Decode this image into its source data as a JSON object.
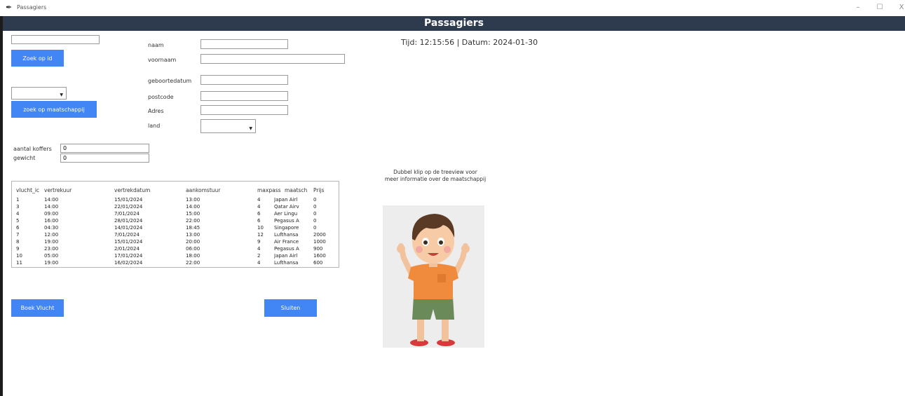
{
  "window": {
    "title": "Passagiers",
    "controls": {
      "minimize": "–",
      "maximize": "☐",
      "close": "X"
    }
  },
  "header": {
    "title": "Passagiers"
  },
  "clock": {
    "text": "Tijd: 12:15:56 | Datum: 2024-01-30"
  },
  "search": {
    "id_value": "",
    "id_button": "Zoek op id",
    "company_value": "",
    "company_button": "zoek op maatschappij"
  },
  "form": {
    "naam_label": "naam",
    "naam_value": "",
    "voornaam_label": "voornaam",
    "voornaam_value": "",
    "geboortedatum_label": "geboortedatum",
    "geboortedatum_value": "",
    "postcode_label": "postcode",
    "postcode_value": "",
    "adres_label": "Adres",
    "adres_value": "",
    "land_label": "land",
    "land_value": ""
  },
  "luggage": {
    "koffers_label": "aantal koffers",
    "koffers_value": "0",
    "gewicht_label": "gewicht",
    "gewicht_value": "0"
  },
  "hint": {
    "line1": "Dubbel klip op de treeview voor",
    "line2": "meer informatie over de maatschappij"
  },
  "table": {
    "columns": [
      "vlucht_ic",
      "vertrekuur",
      "vertrekdatum",
      "aankomstuur",
      "maxpass",
      "maatsch",
      "Prijs"
    ],
    "rows": [
      [
        "1",
        "14:00",
        "15/01/2024",
        "13:00",
        "4",
        "Japan Airl",
        "0"
      ],
      [
        "3",
        "14:00",
        "22/01/2024",
        "14:00",
        "4",
        "Qatar Airv",
        "0"
      ],
      [
        "4",
        "09:00",
        "7/01/2024",
        "15:00",
        "6",
        "Aer Lingu",
        "0"
      ],
      [
        "5",
        "16:00",
        "28/01/2024",
        "22:00",
        "6",
        "Pegasus A",
        "0"
      ],
      [
        "6",
        "04:30",
        "14/01/2024",
        "18:45",
        "10",
        "Singapore",
        "0"
      ],
      [
        "7",
        "12:00",
        "7/01/2024",
        "13:00",
        "12",
        "Lufthansa",
        "2000"
      ],
      [
        "8",
        "19:00",
        "15/01/2024",
        "20:00",
        "9",
        "Air France",
        "1000"
      ],
      [
        "9",
        "23:00",
        "2/01/2024",
        "06:00",
        "4",
        "Pegasus A",
        "900"
      ],
      [
        "10",
        "05:00",
        "17/01/2024",
        "18:00",
        "2",
        "Japan Airl",
        "1600"
      ],
      [
        "11",
        "19:00",
        "16/02/2024",
        "22:00",
        "4",
        "Lufthansa",
        "600"
      ]
    ]
  },
  "actions": {
    "book": "Boek Vlucht",
    "close": "Sluiten"
  },
  "colors": {
    "header_bg": "#2e3b4e",
    "button_bg": "#4285f4"
  },
  "icons": {
    "app": "feather-icon",
    "picture": "boy-illustration"
  }
}
